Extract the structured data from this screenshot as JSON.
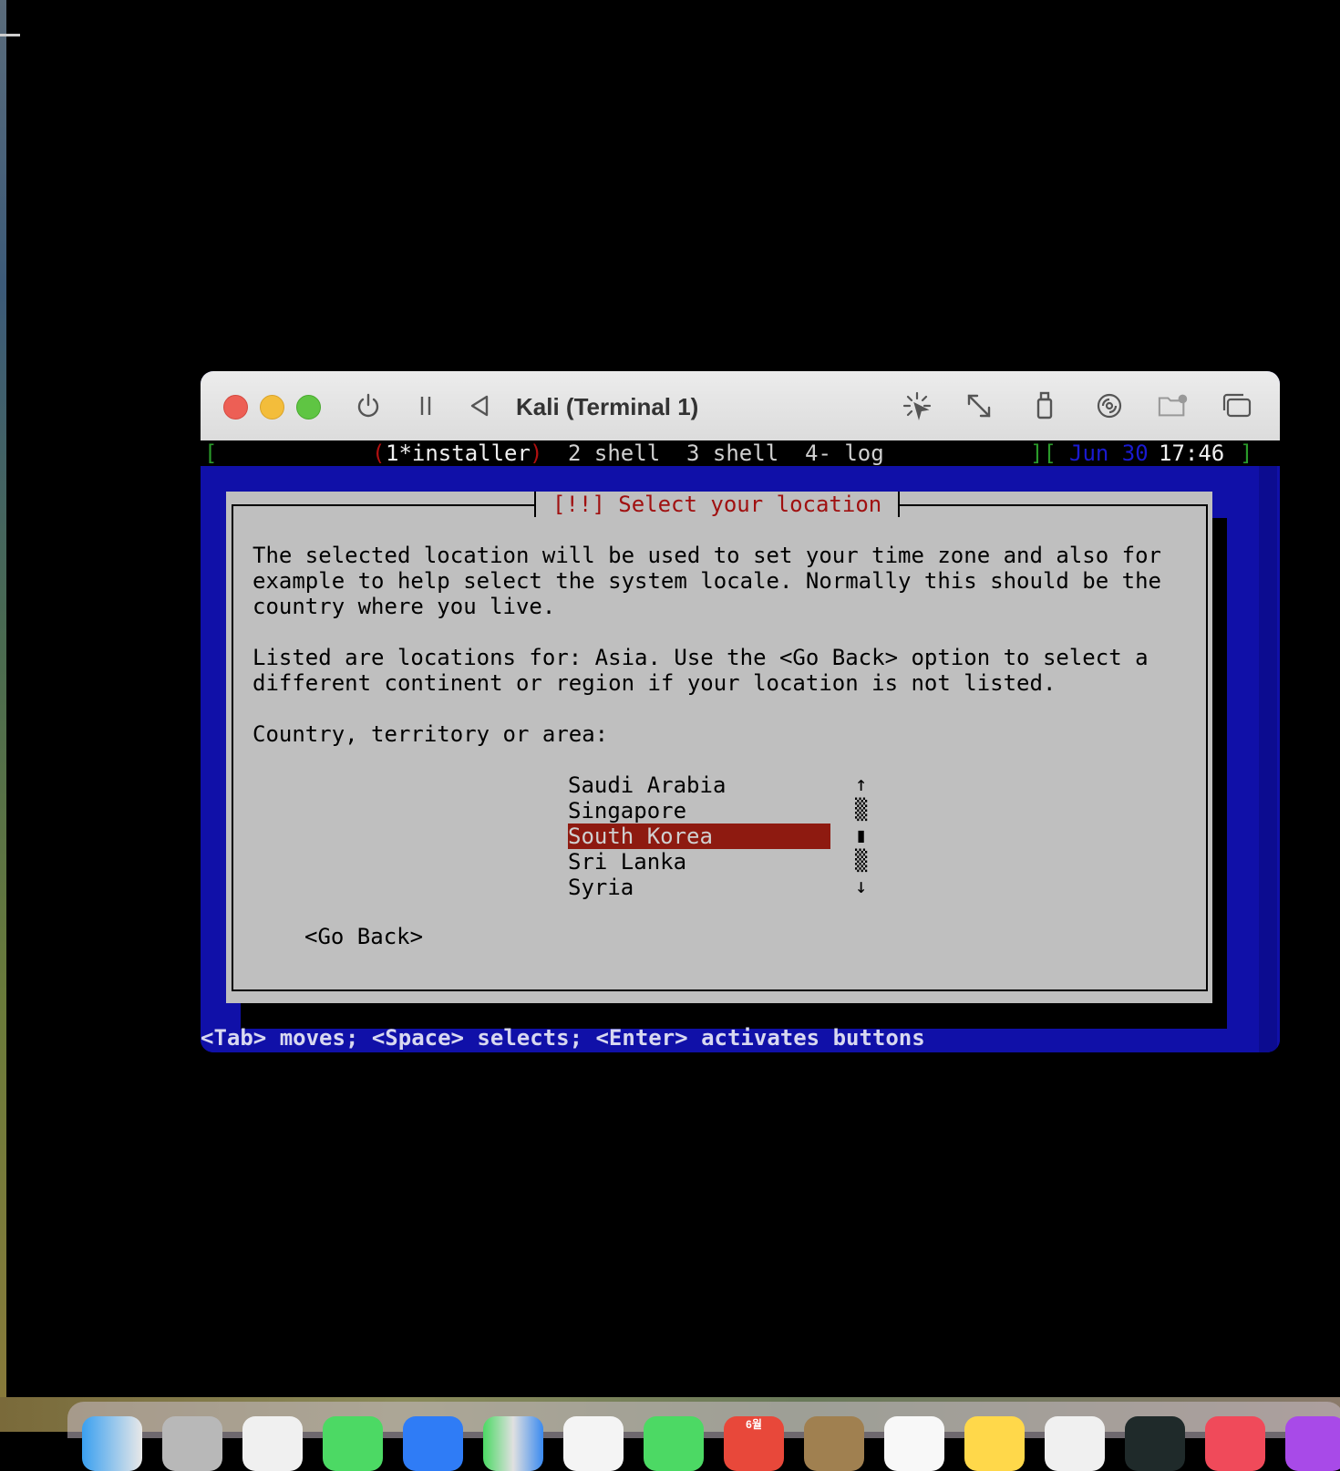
{
  "window": {
    "title": "Kali (Terminal 1)"
  },
  "status_bar": {
    "left_bracket": "[",
    "open_paren": "(",
    "active_window": "1*installer",
    "close_paren": ")",
    "window_2": "2 shell",
    "window_3": "3 shell",
    "window_4": "4- log",
    "right_bracket_sep": "][",
    "date": "Jun 30",
    "time": "17:46",
    "end_bracket": "]"
  },
  "dialog": {
    "title": "[!!] Select your location",
    "paragraph1": [
      "The selected location will be used to set your time zone and also for",
      "example to help select the system locale. Normally this should be the",
      "country where you live."
    ],
    "paragraph2": [
      "Listed are locations for: Asia. Use the <Go Back> option to select a",
      "different continent or region if your location is not listed."
    ],
    "prompt": "Country, territory or area:",
    "countries": [
      "Saudi Arabia",
      "Singapore",
      "South Korea",
      "Sri Lanka",
      "Syria"
    ],
    "selected_country": "South Korea",
    "go_back": "<Go Back>"
  },
  "help_line": "<Tab> moves; <Space> selects; <Enter> activates buttons",
  "dock": {
    "calendar_label": "6월"
  },
  "colors": {
    "screen_blue": "#1010a8",
    "dialog_gray": "#bfbfbf",
    "title_red": "#a01010",
    "selection_red": "#8e1a10",
    "status_green": "#2a9a2a",
    "status_date_blue": "#1a1ad0"
  }
}
